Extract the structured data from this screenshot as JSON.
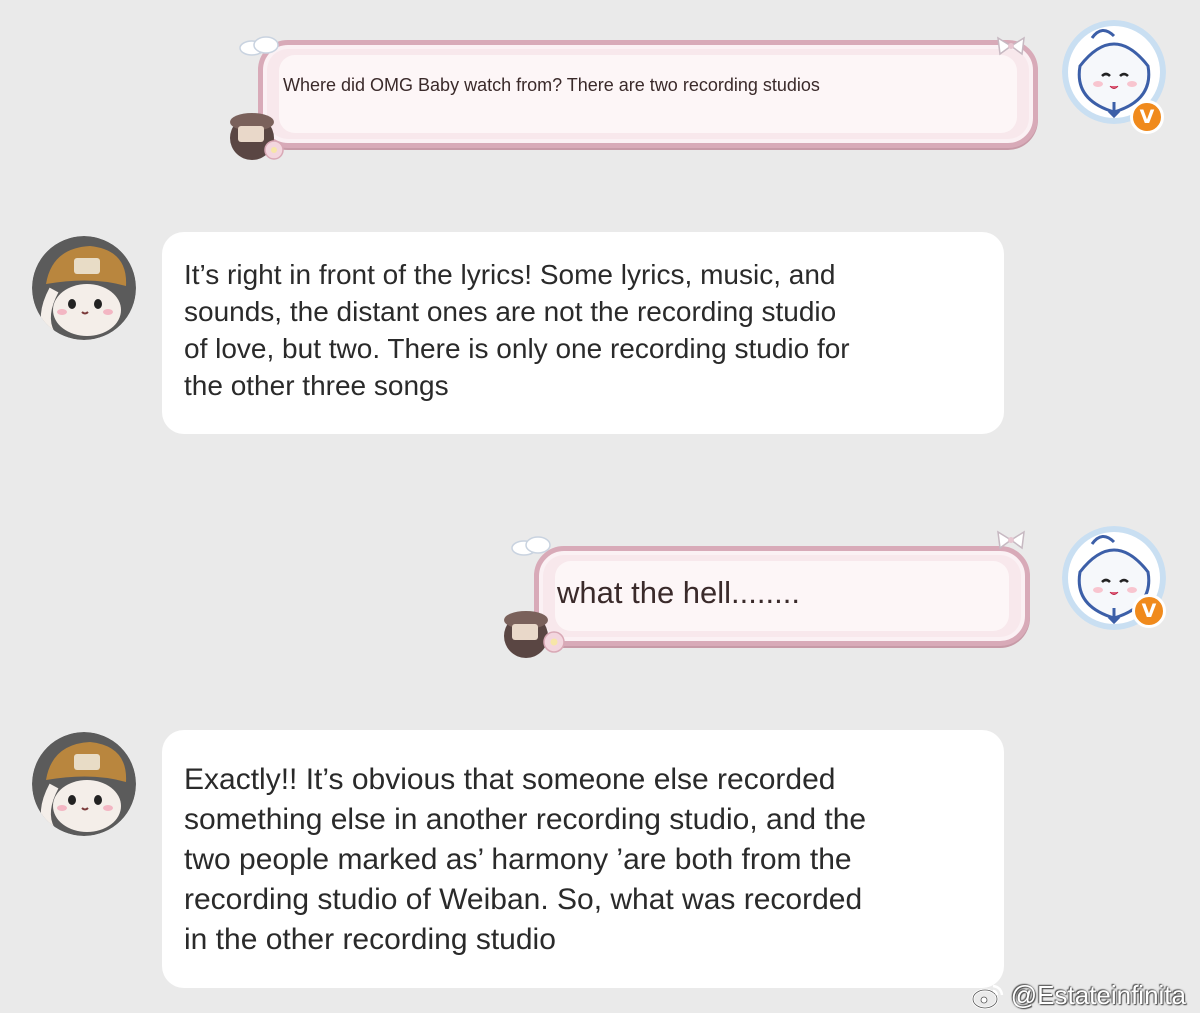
{
  "messages": [
    {
      "sender": "me",
      "text": "Where did OMG Baby watch from? There are two recording studios"
    },
    {
      "sender": "other",
      "lines": [
        "It’s right in front of the lyrics! Some lyrics, music, and",
        "sounds, the distant ones are not the recording studio",
        "of love, but two. There is only one recording studio for",
        "the other three songs"
      ]
    },
    {
      "sender": "me",
      "text": "what the hell........"
    },
    {
      "sender": "other",
      "lines": [
        "Exactly!! It’s obvious that someone else recorded",
        "something else in another recording studio, and the",
        "two people marked as’ harmony ’are both from the",
        "recording studio of Weiban. So, what was recorded",
        "in the other recording studio"
      ]
    }
  ],
  "badges": {
    "vip": "V"
  },
  "watermark": {
    "handle": "@Estateinfinita"
  },
  "colors": {
    "background": "#eaeaea",
    "sent_bubble": "#f8e8ec",
    "sent_border": "#d8aab8",
    "received_bubble": "#ffffff",
    "vip_badge": "#f08a1c"
  }
}
